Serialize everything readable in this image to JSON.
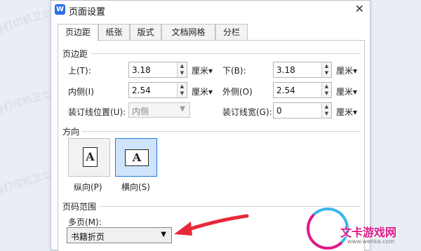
{
  "dialog": {
    "app_icon": "W",
    "title": "页面设置",
    "close": "✕"
  },
  "tabs": [
    "页边距",
    "纸张",
    "版式",
    "文档网格",
    "分栏"
  ],
  "margins": {
    "section_title": "页边距",
    "top_label": "上(T):",
    "top_value": "3.18",
    "bottom_label": "下(B):",
    "bottom_value": "3.18",
    "inner_label": "内侧(I)",
    "inner_value": "2.54",
    "outer_label": "外侧(O)",
    "outer_value": "2.54",
    "gutter_pos_label": "装订线位置(U):",
    "gutter_pos_value": "内侧",
    "gutter_width_label": "装订线宽(G):",
    "gutter_width_value": "0",
    "unit": "厘米▾"
  },
  "orientation": {
    "section_title": "方向",
    "portrait_label": "纵向(P)",
    "landscape_label": "横向(S)",
    "icon_letter": "A",
    "selected": "landscape"
  },
  "pages": {
    "section_title": "页码范围",
    "multiple_label": "多页(M):",
    "multiple_value": "书籍折页"
  },
  "watermark_text": "@打印机卫士",
  "logo": {
    "text": "文卡游戏网",
    "sub": "www.wenka.com"
  },
  "colors": {
    "accent": "#1f7adb",
    "arrow": "#e8293a"
  }
}
